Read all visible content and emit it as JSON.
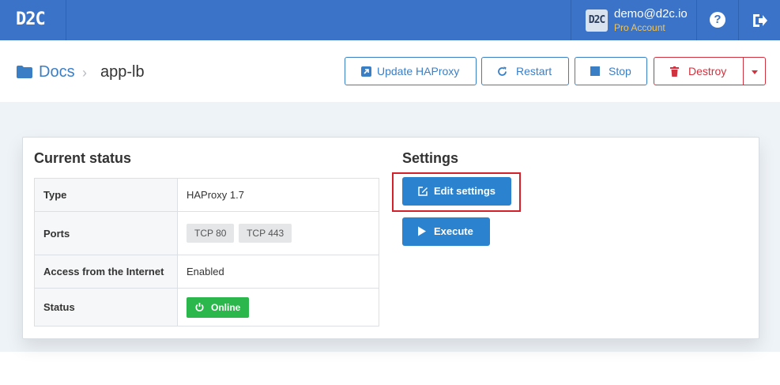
{
  "navbar": {
    "logo": "D2C",
    "avatar_text": "D2C",
    "user_email": "demo@d2c.io",
    "user_plan": "Pro Account",
    "help_glyph": "?",
    "icons": [
      "help-icon",
      "logout-icon"
    ],
    "colors": {
      "bar": "#3a73c7",
      "plan": "#f5c451"
    }
  },
  "breadcrumb": {
    "parent": "Docs",
    "separator": "›",
    "current": "app-lb",
    "icon": "folder-icon"
  },
  "actions": {
    "update_label": "Update HAProxy",
    "restart_label": "Restart",
    "stop_label": "Stop",
    "destroy_label": "Destroy",
    "icons": [
      "external-link-icon",
      "refresh-icon",
      "stop-icon",
      "trash-icon",
      "caret-down-icon"
    ],
    "colors": {
      "primary": "#3a7fc6",
      "danger": "#d0333f"
    }
  },
  "status": {
    "title": "Current status",
    "rows": [
      {
        "key": "Type",
        "value": "HAProxy 1.7"
      },
      {
        "key": "Ports",
        "ports": [
          "TCP 80",
          "TCP 443"
        ]
      },
      {
        "key": "Access from the Internet",
        "value": "Enabled"
      },
      {
        "key": "Status",
        "badge": "Online"
      }
    ],
    "colors": {
      "online": "#2bb74b"
    }
  },
  "settings": {
    "title": "Settings",
    "edit_label": "Edit settings",
    "execute_label": "Execute",
    "icons": [
      "edit-icon",
      "play-icon"
    ],
    "colors": {
      "button": "#2b83cf",
      "highlight": "#d3202a"
    }
  }
}
